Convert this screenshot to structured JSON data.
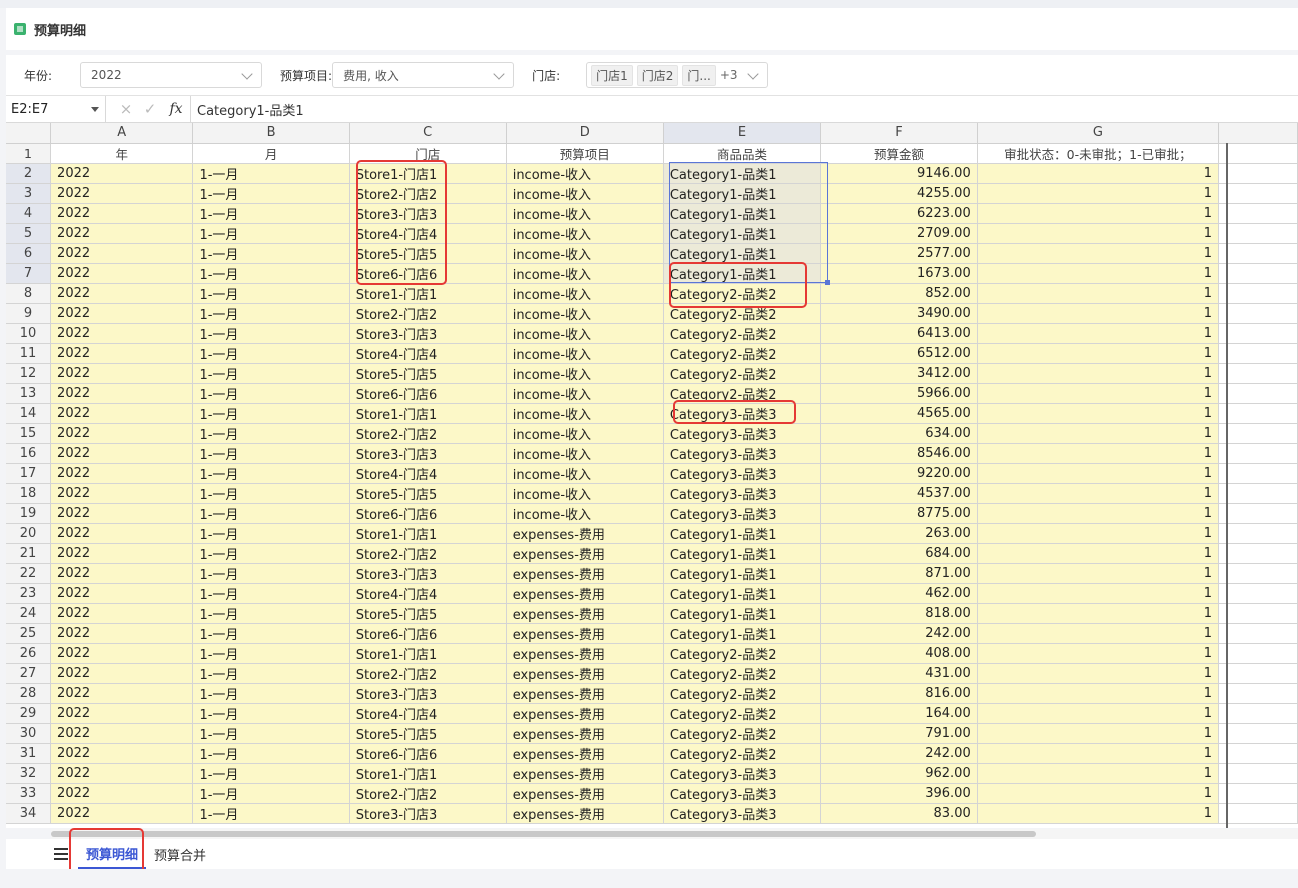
{
  "title": "预算明细",
  "filters": {
    "year_label": "年份:",
    "year_value": "2022",
    "budget_item_label": "预算项目:",
    "budget_item_value": "费用, 收入",
    "store_label": "门店:",
    "store_tags": [
      "门店1",
      "门店2",
      "门..."
    ],
    "store_more": "+3"
  },
  "formula_bar": {
    "name_box": "E2:E7",
    "cancel_icon": "×",
    "confirm_icon": "✓",
    "fx": "fx",
    "content": "Category1-品类1"
  },
  "columns": [
    "A",
    "B",
    "C",
    "D",
    "E",
    "F",
    "G"
  ],
  "header_row": [
    "年",
    "月",
    "门店",
    "预算项目",
    "商品品类",
    "预算金额",
    "审批状态：0-未审批；1-已审批；"
  ],
  "rows": [
    [
      "2022",
      "1-一月",
      "Store1-门店1",
      "income-收入",
      "Category1-品类1",
      "9146.00",
      "1"
    ],
    [
      "2022",
      "1-一月",
      "Store2-门店2",
      "income-收入",
      "Category1-品类1",
      "4255.00",
      "1"
    ],
    [
      "2022",
      "1-一月",
      "Store3-门店3",
      "income-收入",
      "Category1-品类1",
      "6223.00",
      "1"
    ],
    [
      "2022",
      "1-一月",
      "Store4-门店4",
      "income-收入",
      "Category1-品类1",
      "2709.00",
      "1"
    ],
    [
      "2022",
      "1-一月",
      "Store5-门店5",
      "income-收入",
      "Category1-品类1",
      "2577.00",
      "1"
    ],
    [
      "2022",
      "1-一月",
      "Store6-门店6",
      "income-收入",
      "Category1-品类1",
      "1673.00",
      "1"
    ],
    [
      "2022",
      "1-一月",
      "Store1-门店1",
      "income-收入",
      "Category2-品类2",
      "852.00",
      "1"
    ],
    [
      "2022",
      "1-一月",
      "Store2-门店2",
      "income-收入",
      "Category2-品类2",
      "3490.00",
      "1"
    ],
    [
      "2022",
      "1-一月",
      "Store3-门店3",
      "income-收入",
      "Category2-品类2",
      "6413.00",
      "1"
    ],
    [
      "2022",
      "1-一月",
      "Store4-门店4",
      "income-收入",
      "Category2-品类2",
      "6512.00",
      "1"
    ],
    [
      "2022",
      "1-一月",
      "Store5-门店5",
      "income-收入",
      "Category2-品类2",
      "3412.00",
      "1"
    ],
    [
      "2022",
      "1-一月",
      "Store6-门店6",
      "income-收入",
      "Category2-品类2",
      "5966.00",
      "1"
    ],
    [
      "2022",
      "1-一月",
      "Store1-门店1",
      "income-收入",
      "Category3-品类3",
      "4565.00",
      "1"
    ],
    [
      "2022",
      "1-一月",
      "Store2-门店2",
      "income-收入",
      "Category3-品类3",
      "634.00",
      "1"
    ],
    [
      "2022",
      "1-一月",
      "Store3-门店3",
      "income-收入",
      "Category3-品类3",
      "8546.00",
      "1"
    ],
    [
      "2022",
      "1-一月",
      "Store4-门店4",
      "income-收入",
      "Category3-品类3",
      "9220.00",
      "1"
    ],
    [
      "2022",
      "1-一月",
      "Store5-门店5",
      "income-收入",
      "Category3-品类3",
      "4537.00",
      "1"
    ],
    [
      "2022",
      "1-一月",
      "Store6-门店6",
      "income-收入",
      "Category3-品类3",
      "8775.00",
      "1"
    ],
    [
      "2022",
      "1-一月",
      "Store1-门店1",
      "expenses-费用",
      "Category1-品类1",
      "263.00",
      "1"
    ],
    [
      "2022",
      "1-一月",
      "Store2-门店2",
      "expenses-费用",
      "Category1-品类1",
      "684.00",
      "1"
    ],
    [
      "2022",
      "1-一月",
      "Store3-门店3",
      "expenses-费用",
      "Category1-品类1",
      "871.00",
      "1"
    ],
    [
      "2022",
      "1-一月",
      "Store4-门店4",
      "expenses-费用",
      "Category1-品类1",
      "462.00",
      "1"
    ],
    [
      "2022",
      "1-一月",
      "Store5-门店5",
      "expenses-费用",
      "Category1-品类1",
      "818.00",
      "1"
    ],
    [
      "2022",
      "1-一月",
      "Store6-门店6",
      "expenses-费用",
      "Category1-品类1",
      "242.00",
      "1"
    ],
    [
      "2022",
      "1-一月",
      "Store1-门店1",
      "expenses-费用",
      "Category2-品类2",
      "408.00",
      "1"
    ],
    [
      "2022",
      "1-一月",
      "Store2-门店2",
      "expenses-费用",
      "Category2-品类2",
      "431.00",
      "1"
    ],
    [
      "2022",
      "1-一月",
      "Store3-门店3",
      "expenses-费用",
      "Category2-品类2",
      "816.00",
      "1"
    ],
    [
      "2022",
      "1-一月",
      "Store4-门店4",
      "expenses-费用",
      "Category2-品类2",
      "164.00",
      "1"
    ],
    [
      "2022",
      "1-一月",
      "Store5-门店5",
      "expenses-费用",
      "Category2-品类2",
      "791.00",
      "1"
    ],
    [
      "2022",
      "1-一月",
      "Store6-门店6",
      "expenses-费用",
      "Category2-品类2",
      "242.00",
      "1"
    ],
    [
      "2022",
      "1-一月",
      "Store1-门店1",
      "expenses-费用",
      "Category3-品类3",
      "962.00",
      "1"
    ],
    [
      "2022",
      "1-一月",
      "Store2-门店2",
      "expenses-费用",
      "Category3-品类3",
      "396.00",
      "1"
    ],
    [
      "2022",
      "1-一月",
      "Store3-门店3",
      "expenses-费用",
      "Category3-品类3",
      "83.00",
      "1"
    ]
  ],
  "sheet_tabs": [
    "预算明细",
    "预算合并"
  ],
  "colors": {
    "data_fill": "#fcf8c8",
    "selection": "#5a76d6",
    "annotation": "#e53935",
    "active_tab": "#3b57d4"
  }
}
